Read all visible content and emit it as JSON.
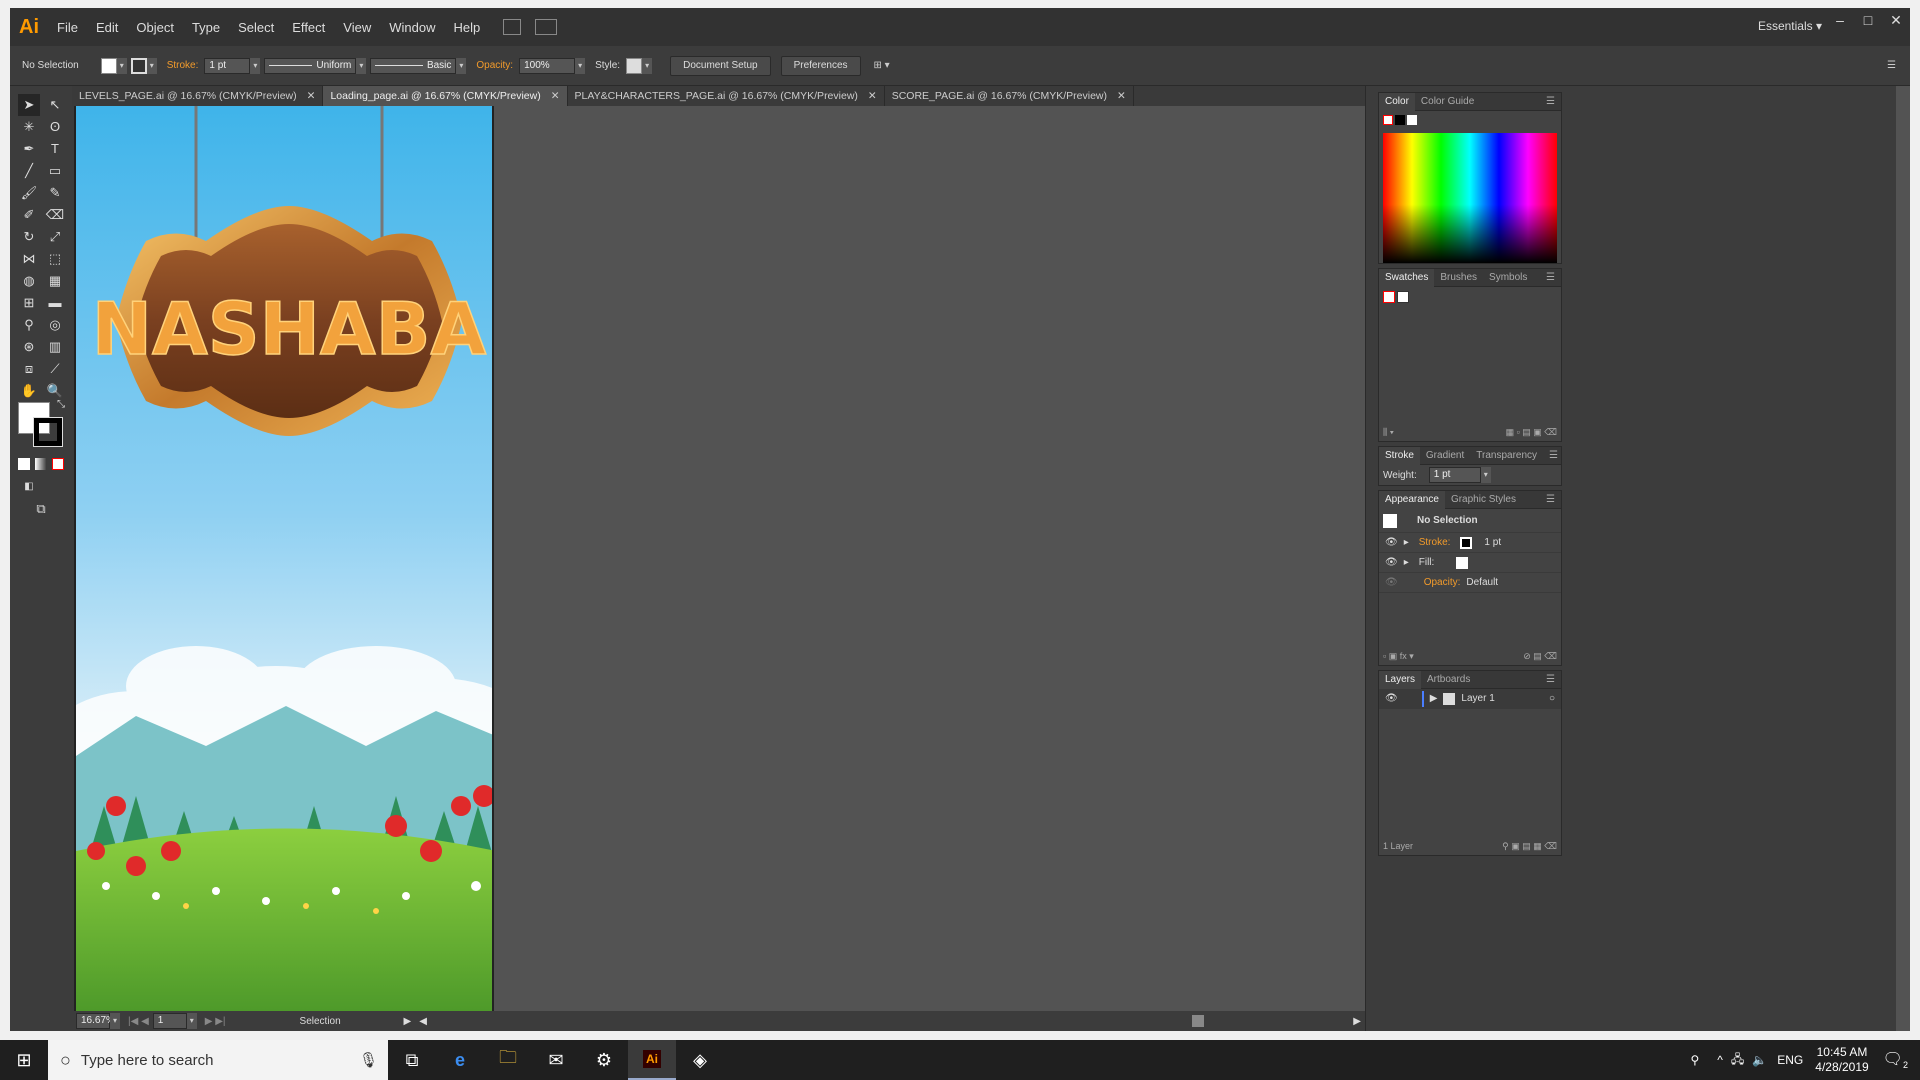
{
  "app": {
    "logo": "Ai",
    "workspace": "Essentials"
  },
  "menu": [
    "File",
    "Edit",
    "Object",
    "Type",
    "Select",
    "Effect",
    "View",
    "Window",
    "Help"
  ],
  "control_bar": {
    "selection": "No Selection",
    "stroke_label": "Stroke:",
    "stroke_value": "1 pt",
    "profile": "Uniform",
    "brush": "Basic",
    "opacity_label": "Opacity:",
    "opacity_value": "100%",
    "style_label": "Style:",
    "doc_setup": "Document Setup",
    "preferences": "Preferences"
  },
  "tabs": [
    {
      "label": "LEVELS_PAGE.ai @ 16.67% (CMYK/Preview)"
    },
    {
      "label": "Loading_page.ai @ 16.67% (CMYK/Preview)"
    },
    {
      "label": "PLAY&CHARACTERS_PAGE.ai @ 16.67% (CMYK/Preview)"
    },
    {
      "label": "SCORE_PAGE.ai @ 16.67% (CMYK/Preview)"
    }
  ],
  "artwork": {
    "sign_text": "NASHABA"
  },
  "status": {
    "zoom": "16.67%",
    "page": "1",
    "tool": "Selection"
  },
  "panels": {
    "color": {
      "tabs": [
        "Color",
        "Color Guide"
      ]
    },
    "swatches": {
      "tabs": [
        "Swatches",
        "Brushes",
        "Symbols"
      ]
    },
    "stroke": {
      "tabs": [
        "Stroke",
        "Gradient",
        "Transparency"
      ],
      "weight_label": "Weight:",
      "weight_value": "1 pt"
    },
    "appearance": {
      "tabs": [
        "Appearance",
        "Graphic Styles"
      ],
      "title": "No Selection",
      "stroke_label": "Stroke:",
      "stroke_value": "1 pt",
      "fill_label": "Fill:",
      "opacity_label": "Opacity:",
      "opacity_value": "Default"
    },
    "layers": {
      "tabs": [
        "Layers",
        "Artboards"
      ],
      "layer_name": "Layer 1",
      "count": "1 Layer"
    }
  },
  "taskbar": {
    "search_placeholder": "Type here to search",
    "lang": "ENG",
    "time": "10:45 AM",
    "date": "4/28/2019",
    "notifications": "2"
  }
}
